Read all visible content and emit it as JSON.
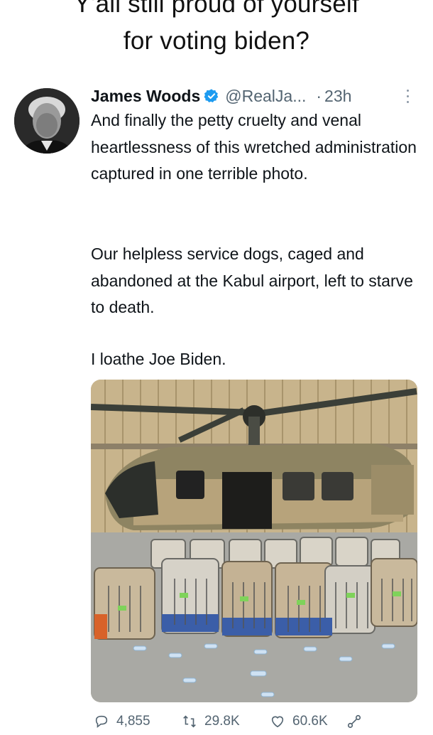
{
  "caption": {
    "line1": "Y'all still proud of yourself",
    "line2": "for voting biden?"
  },
  "tweet": {
    "author_name": "James Woods",
    "handle": "@RealJa...",
    "separator": "·",
    "time": "23h",
    "verified": true,
    "paragraphs": [
      "And finally the petty cruelty and venal heartlessness of this wretched administration captured in one terrible photo.",
      "Our helpless service dogs, caged and abandoned at the Kabul airport, left to starve to death.",
      "I loathe Joe Biden."
    ]
  },
  "stats": {
    "replies": "4,855",
    "retweets": "29.8K",
    "likes": "60.6K"
  },
  "icons": [
    "verified-badge-icon",
    "more-options-icon",
    "reply-icon",
    "retweet-icon",
    "like-icon",
    "share-icon"
  ],
  "colors": {
    "verified_blue": "#1d9bf0",
    "text": "#0f1419",
    "muted": "#536471"
  }
}
